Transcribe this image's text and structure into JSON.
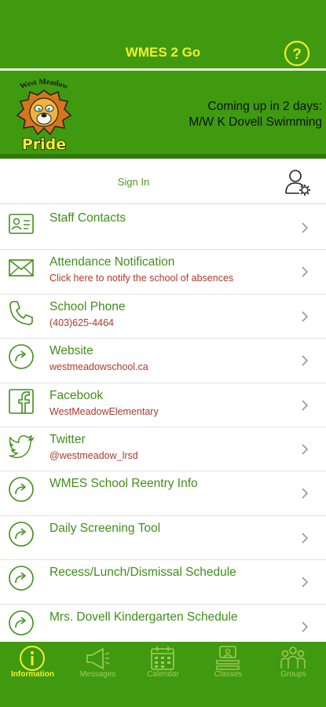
{
  "header": {
    "title": "WMES 2 Go",
    "help_icon": "help-circle-icon",
    "logo": {
      "arc_text": "West Meadow",
      "word": "Pride"
    },
    "upcoming_line1": "Coming up in 2 days:",
    "upcoming_line2": "M/W K Dovell Swimming"
  },
  "signin": {
    "label": "Sign In",
    "icon": "user-settings-icon"
  },
  "list": [
    {
      "title": "Staff Contacts",
      "sub": "",
      "icon": "contact-card-icon"
    },
    {
      "title": "Attendance Notification",
      "sub": "Click here to notify the school of absences",
      "icon": "envelope-icon"
    },
    {
      "title": "School Phone",
      "sub": "(403)625-4464",
      "icon": "phone-icon"
    },
    {
      "title": "Website",
      "sub": "westmeadowschool.ca",
      "icon": "link-arrow-icon"
    },
    {
      "title": "Facebook",
      "sub": "WestMeadowElementary",
      "icon": "facebook-icon"
    },
    {
      "title": "Twitter",
      "sub": "@westmeadow_lrsd",
      "icon": "twitter-icon"
    },
    {
      "title": "WMES School Reentry Info",
      "sub": "",
      "icon": "link-arrow-icon"
    },
    {
      "title": "Daily Screening Tool",
      "sub": "",
      "icon": "link-arrow-icon"
    },
    {
      "title": "Recess/Lunch/Dismissal Schedule",
      "sub": "",
      "icon": "link-arrow-icon"
    },
    {
      "title": "Mrs. Dovell Kindergarten Schedule",
      "sub": "",
      "icon": "link-arrow-icon"
    }
  ],
  "tabs": [
    {
      "label": "Information",
      "icon": "info-icon",
      "active": true
    },
    {
      "label": "Messages",
      "icon": "megaphone-icon",
      "active": false
    },
    {
      "label": "Calendar",
      "icon": "calendar-icon",
      "active": false
    },
    {
      "label": "Classes",
      "icon": "classes-icon",
      "active": false
    },
    {
      "label": "Groups",
      "icon": "groups-icon",
      "active": false
    }
  ],
  "colors": {
    "brand_green": "#3f9a10",
    "accent_yellow": "#f3ee2a",
    "row_title": "#3f8f18",
    "row_sub": "#b0392b"
  }
}
